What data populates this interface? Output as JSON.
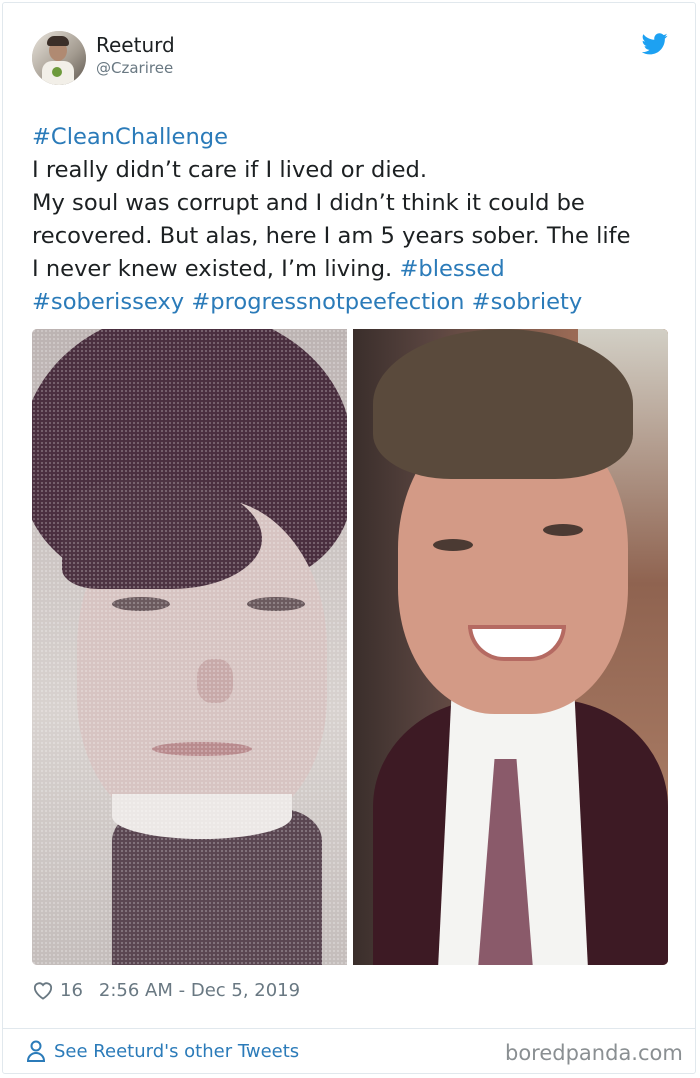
{
  "author": {
    "name": "Reeturd",
    "handle": "@Czariree",
    "avatar_icon": "user-avatar"
  },
  "tweet": {
    "lines": [
      [
        {
          "t": "#CleanChallenge",
          "tag": true
        }
      ],
      [
        {
          "t": "I really didn’t care if I lived or died.",
          "tag": false
        }
      ],
      [
        {
          "t": "My soul was corrupt and I didn’t think it could be",
          "tag": false
        }
      ],
      [
        {
          "t": "recovered. But alas, here I am 5 years sober. The life",
          "tag": false
        }
      ],
      [
        {
          "t": "I never knew existed, I’m living. ",
          "tag": false
        },
        {
          "t": "#blessed",
          "tag": true
        }
      ],
      [
        {
          "t": "#soberissexy",
          "tag": true
        },
        {
          "t": " ",
          "tag": false
        },
        {
          "t": "#progressnotpeefection",
          "tag": true
        },
        {
          "t": " ",
          "tag": false
        },
        {
          "t": "#sobriety",
          "tag": true
        }
      ]
    ]
  },
  "meta": {
    "likes": "16",
    "timestamp": "2:56 AM - Dec 5, 2019"
  },
  "footer": {
    "see_more": "See Reeturd's other Tweets",
    "watermark": "boredpanda.com"
  },
  "colors": {
    "link": "#2b7bb9",
    "text": "#1c2022",
    "muted": "#697882",
    "twitter_blue": "#1da1f2"
  },
  "icons": {
    "twitter": "twitter-bird-icon",
    "like": "heart-icon",
    "profile": "person-icon"
  }
}
